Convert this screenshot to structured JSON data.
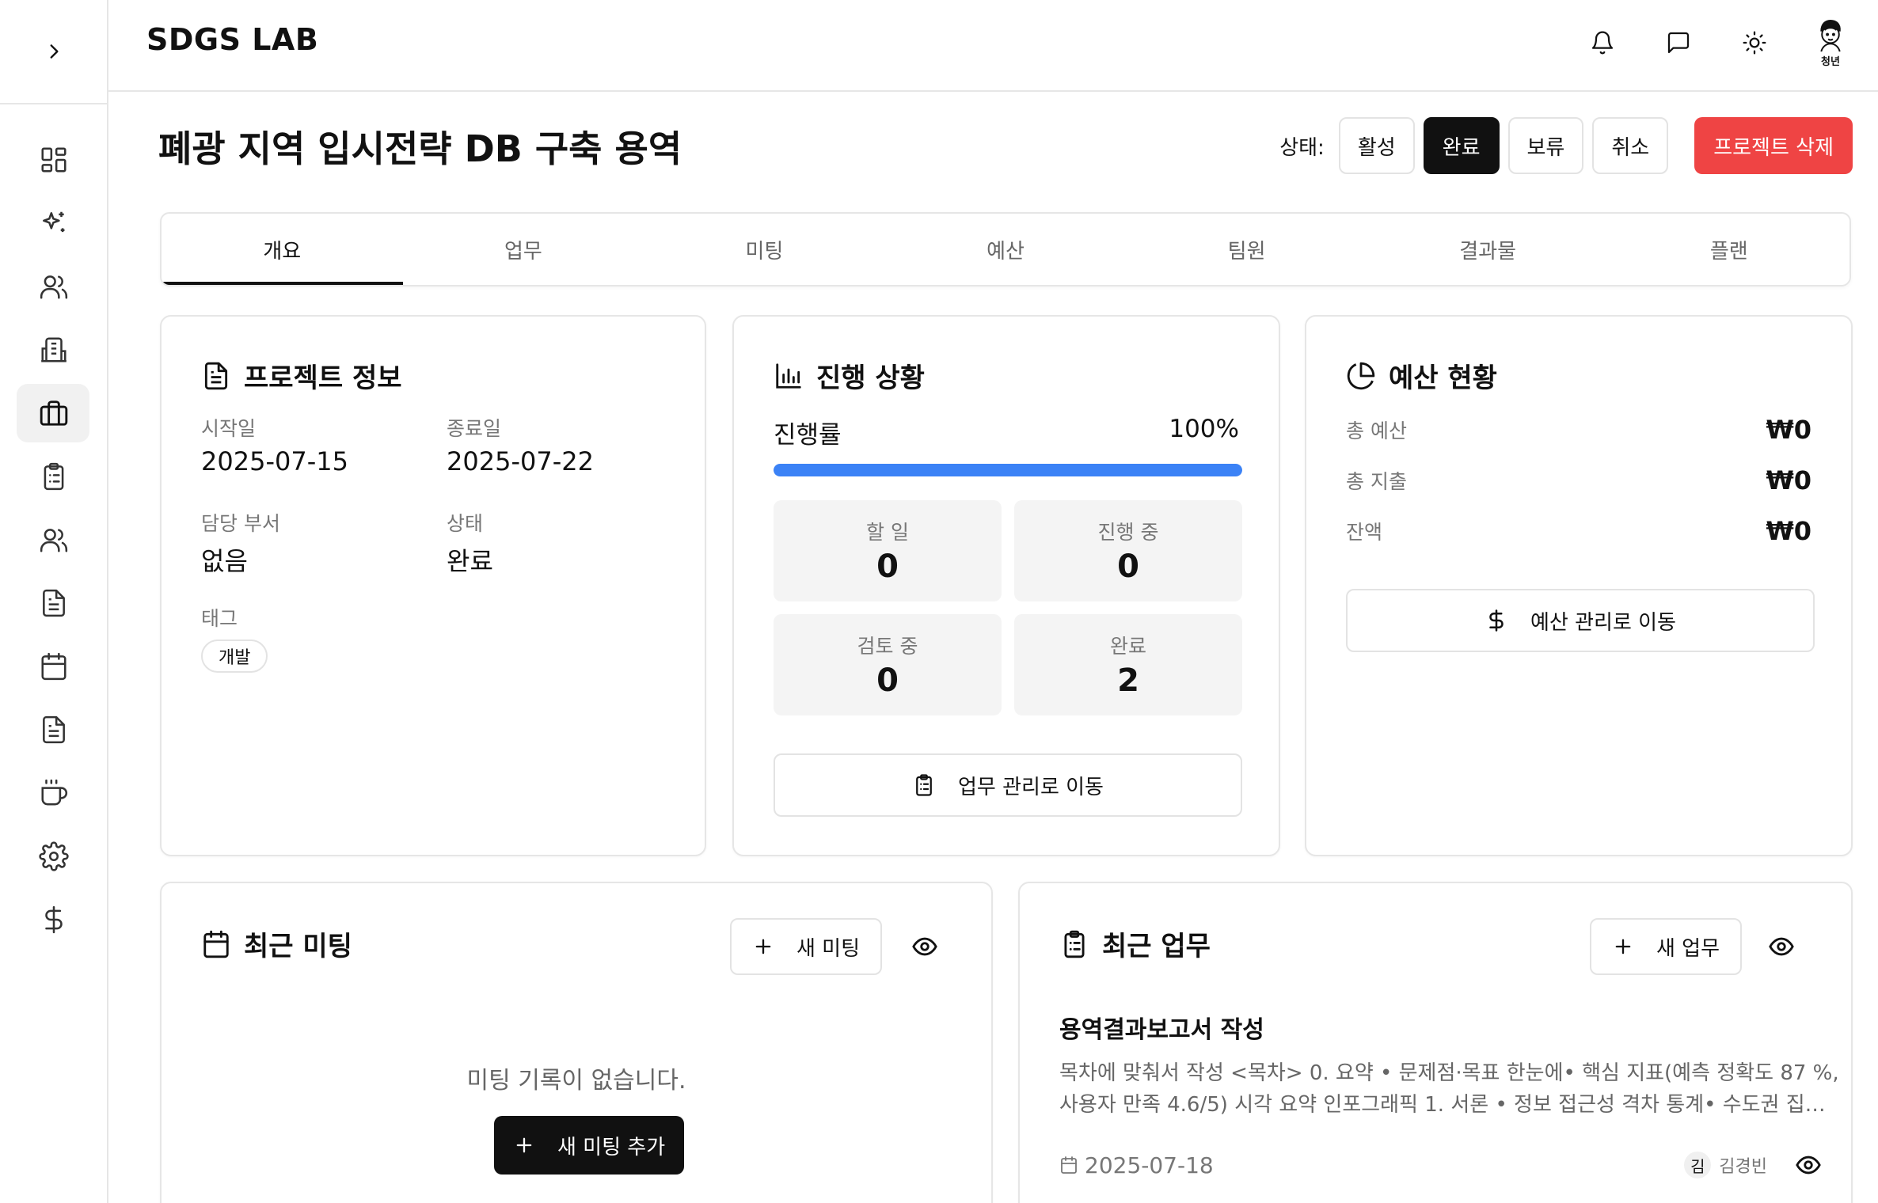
{
  "app": {
    "brand": "SDGS LAB",
    "avatar_caption": "청년"
  },
  "sidebar": {
    "toggle_icon": "chevron-right-icon",
    "items": [
      {
        "icon": "dashboard-icon",
        "active": false
      },
      {
        "icon": "sparkles-icon",
        "active": false
      },
      {
        "icon": "users-icon",
        "active": false
      },
      {
        "icon": "building-icon",
        "active": false
      },
      {
        "icon": "briefcase-icon",
        "active": true
      },
      {
        "icon": "clipboard-list-icon",
        "active": false
      },
      {
        "icon": "users-icon",
        "active": false
      },
      {
        "icon": "file-text-icon",
        "active": false
      },
      {
        "icon": "calendar-icon",
        "active": false
      },
      {
        "icon": "file-text-icon",
        "active": false
      },
      {
        "icon": "coffee-icon",
        "active": false
      },
      {
        "icon": "settings-icon",
        "active": false
      },
      {
        "icon": "dollar-icon",
        "active": false
      }
    ]
  },
  "header_icons": [
    "bell-icon",
    "message-icon",
    "sun-icon",
    "avatar"
  ],
  "project": {
    "title": "폐광 지역 입시전략 DB 구축 용역",
    "status_label": "상태:",
    "status_options": [
      "활성",
      "완료",
      "보류",
      "취소"
    ],
    "status_selected": "완료",
    "delete_label": "프로젝트 삭제"
  },
  "tabs": [
    "개요",
    "업무",
    "미팅",
    "예산",
    "팀원",
    "결과물",
    "플랜"
  ],
  "active_tab": "개요",
  "info": {
    "title": "프로젝트 정보",
    "start_label": "시작일",
    "start_value": "2025-07-15",
    "end_label": "종료일",
    "end_value": "2025-07-22",
    "dept_label": "담당 부서",
    "dept_value": "없음",
    "state_label": "상태",
    "state_value": "완료",
    "tag_label": "태그",
    "tags": [
      "개발"
    ]
  },
  "progress": {
    "title": "진행 상황",
    "rate_label": "진행률",
    "rate_text": "100%",
    "rate_value": 1.0,
    "stats": [
      {
        "label": "할 일",
        "value": "0"
      },
      {
        "label": "진행 중",
        "value": "0"
      },
      {
        "label": "검토 중",
        "value": "0"
      },
      {
        "label": "완료",
        "value": "2"
      }
    ],
    "button_label": "업무 관리로 이동"
  },
  "budget": {
    "title": "예산 현황",
    "rows": [
      {
        "label": "총 예산",
        "value": "₩0"
      },
      {
        "label": "총 지출",
        "value": "₩0"
      },
      {
        "label": "잔액",
        "value": "₩0"
      }
    ],
    "button_label": "예산 관리로 이동"
  },
  "meetings": {
    "title": "최근 미팅",
    "new_label": "새 미팅",
    "empty_text": "미팅 기록이 없습니다.",
    "add_label": "새 미팅 추가"
  },
  "tasks": {
    "title": "최근 업무",
    "new_label": "새 업무",
    "items": [
      {
        "title": "용역결과보고서 작성",
        "description": "목차에 맞춰서 작성 <목차> 0. 요약 • 문제점·목표 한눈에• 핵심 지표(예측 정확도 87 %, 사용자 만족 4.6/5) 시각 요약 인포그래픽 1. 서론 • 정보 접근성 격차 통계• 수도권 집중...",
        "date": "2025-07-18",
        "user_initial": "김",
        "user_name": "김경빈"
      }
    ]
  },
  "colors": {
    "accent": "#3b82f6",
    "danger": "#ef4444",
    "dark": "#111111"
  }
}
